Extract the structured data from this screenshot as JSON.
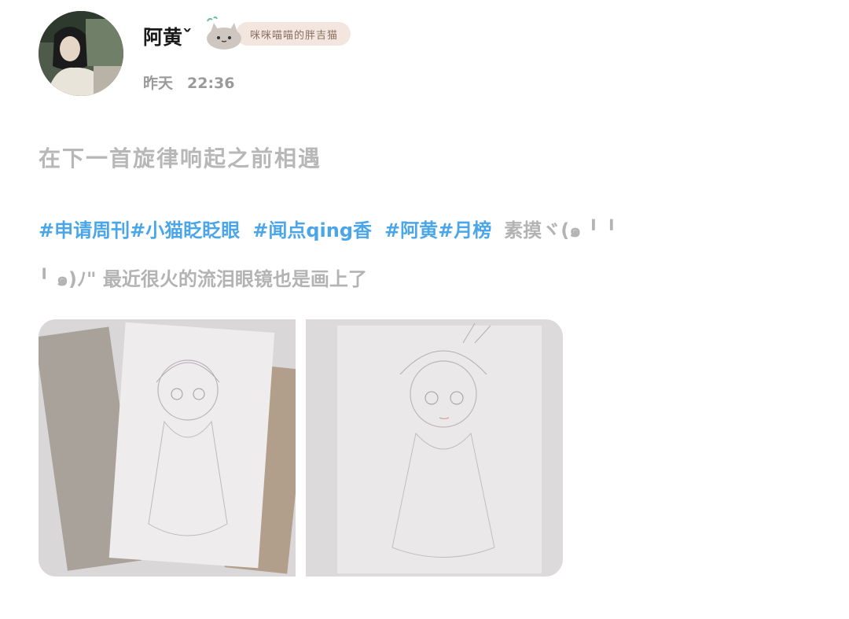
{
  "author": {
    "name": "阿黄ˇ",
    "badge_text": "咪咪喵喵的胖吉猫",
    "badge_icon": "pusheen-cat-icon"
  },
  "post": {
    "date_label": "昨天",
    "time": "22:36",
    "title": "在下一首旋律响起之前相遇",
    "tags": [
      "#申请周刊",
      "#小猫眨眨眼",
      "#闻点qing香",
      "#阿黄",
      "#月榜"
    ],
    "text": "素摸ヾ(๑╹◡╹)ﾉ\" 最近很火的流泪眼镜也是画上了",
    "text_line1": "素摸ヾ(๑ ╹ ╹",
    "text_line2": "╹ ๑)ﾉ\" 最近很火的流泪眼镜也是画上了"
  },
  "colors": {
    "tag": "#4aa6e8",
    "muted_text": "#b3b3b3",
    "badge_bg": "#f3e6df"
  },
  "images": [
    {
      "name": "pencil-sketch-photo-1",
      "description_icon": "sketch-on-newspaper"
    },
    {
      "name": "pencil-sketch-photo-2",
      "description_icon": "sketch-on-desk"
    }
  ]
}
